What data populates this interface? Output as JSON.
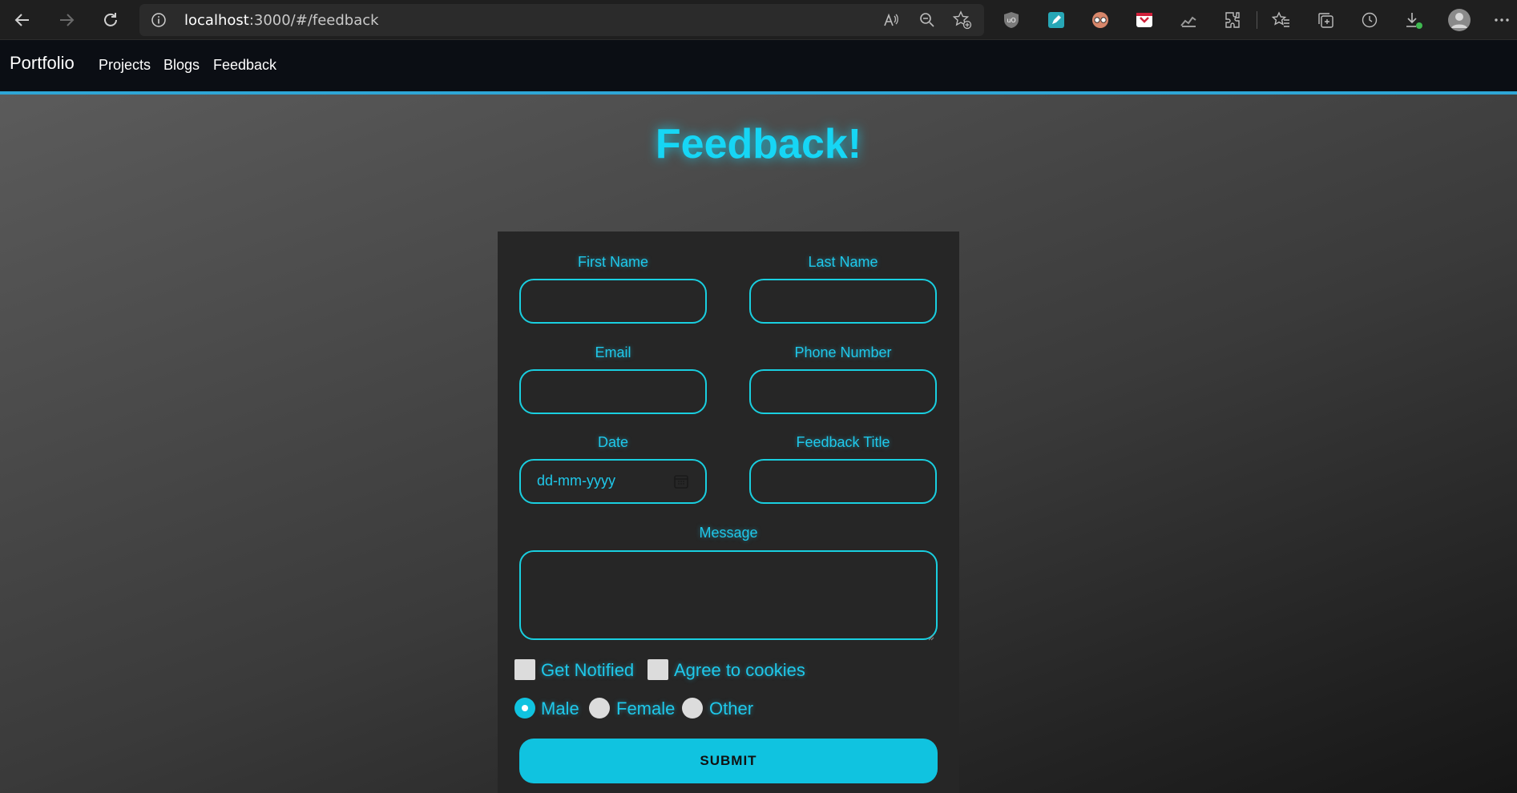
{
  "browser": {
    "url_host": "localhost",
    "url_path": ":3000/#/feedback",
    "icons": [
      "back-icon",
      "forward-icon",
      "refresh-icon",
      "info-icon",
      "read-aloud-icon",
      "zoom-out-icon",
      "add-favorite-icon",
      "ublock-icon",
      "pen-icon",
      "glasses-icon",
      "pocket-icon",
      "stats-icon",
      "extensions-icon",
      "favorites-icon",
      "collections-icon",
      "history-icon",
      "downloads-icon",
      "profile-icon",
      "more-icon"
    ]
  },
  "nav": {
    "brand": "Portfolio",
    "links": [
      "Projects",
      "Blogs",
      "Feedback"
    ]
  },
  "page": {
    "title": "Feedback!"
  },
  "form": {
    "labels": {
      "first_name": "First Name",
      "last_name": "Last Name",
      "email": "Email",
      "phone": "Phone Number",
      "date": "Date",
      "feedback_title": "Feedback Title",
      "message": "Message"
    },
    "date_placeholder": "dd-mm-yyyy",
    "checkboxes": [
      "Get Notified",
      "Agree to cookies"
    ],
    "radios": [
      "Male",
      "Female",
      "Other"
    ],
    "selected_radio": "Male",
    "submit_label": "SUBMIT"
  },
  "colors": {
    "accent": "#16d6f5",
    "nav_bg": "#0b0e14",
    "nav_border": "#2ea6d6",
    "card_bg": "#262626",
    "submit_bg": "#10c3e0"
  }
}
